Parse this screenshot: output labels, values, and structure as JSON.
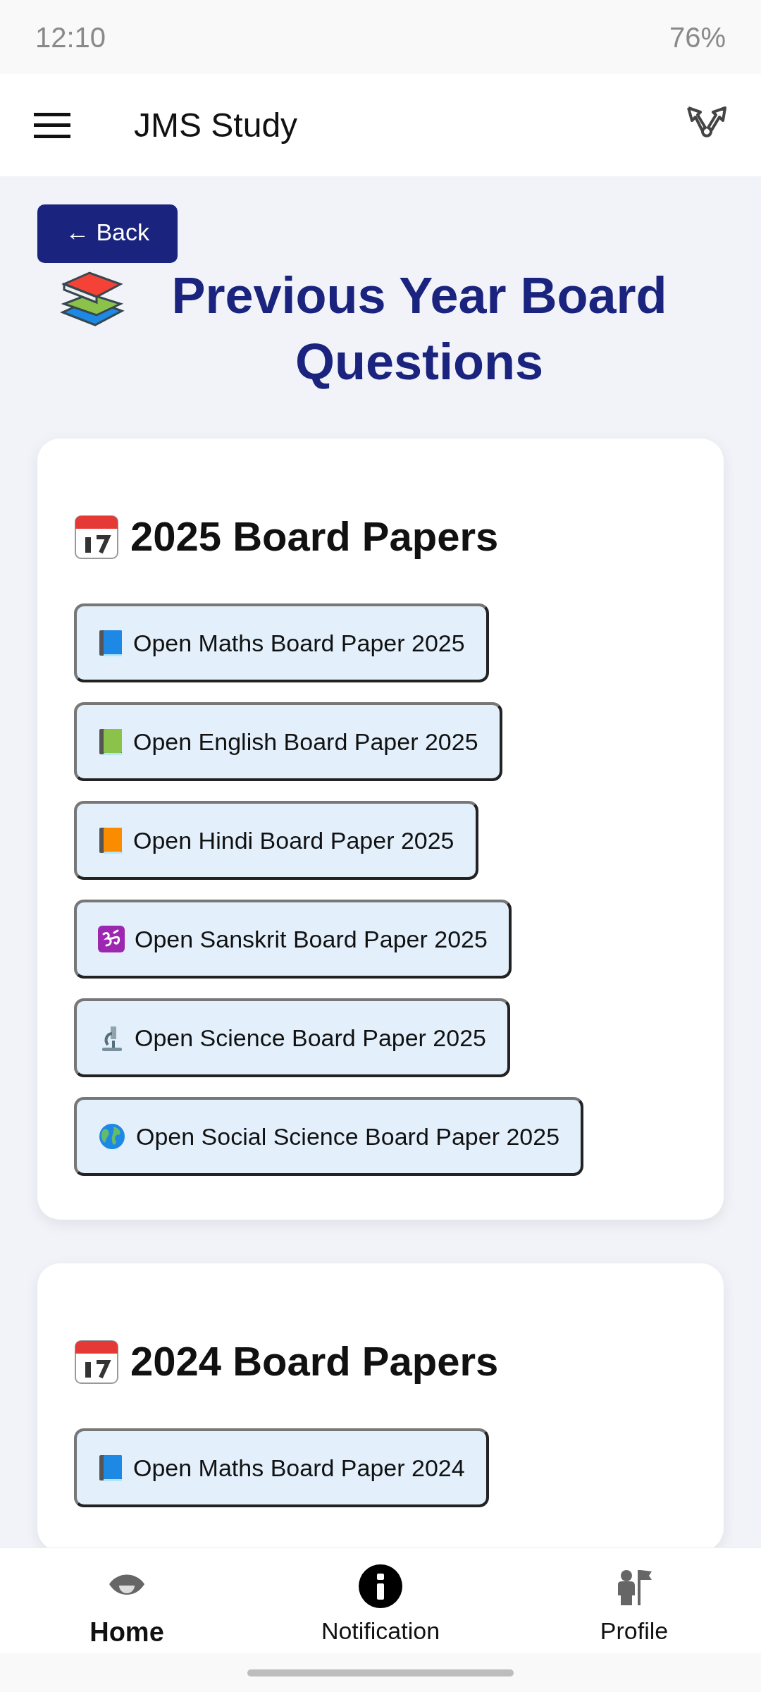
{
  "status_bar": {
    "time": "12:10",
    "battery": "76%"
  },
  "app_bar": {
    "title": "JMS Study"
  },
  "back_button": {
    "label": "← Back"
  },
  "page_title": "Previous Year Board Questions",
  "sections": [
    {
      "title": "2025 Board Papers",
      "papers": [
        {
          "kind": "maths",
          "label": "Open Maths Board Paper 2025"
        },
        {
          "kind": "english",
          "label": "Open English Board Paper 2025"
        },
        {
          "kind": "hindi",
          "label": "Open Hindi Board Paper 2025"
        },
        {
          "kind": "sanskrit",
          "label": "Open Sanskrit Board Paper 2025"
        },
        {
          "kind": "science",
          "label": "Open Science Board Paper 2025"
        },
        {
          "kind": "social",
          "label": "Open Social Science Board Paper 2025"
        }
      ]
    },
    {
      "title": "2024 Board Papers",
      "papers": [
        {
          "kind": "maths",
          "label": "Open Maths Board Paper 2024"
        }
      ]
    }
  ],
  "bottom_nav": [
    {
      "kind": "eye",
      "label": "Home",
      "selected": true
    },
    {
      "kind": "info",
      "label": "Notification",
      "selected": false
    },
    {
      "kind": "person",
      "label": "Profile",
      "selected": false
    }
  ]
}
